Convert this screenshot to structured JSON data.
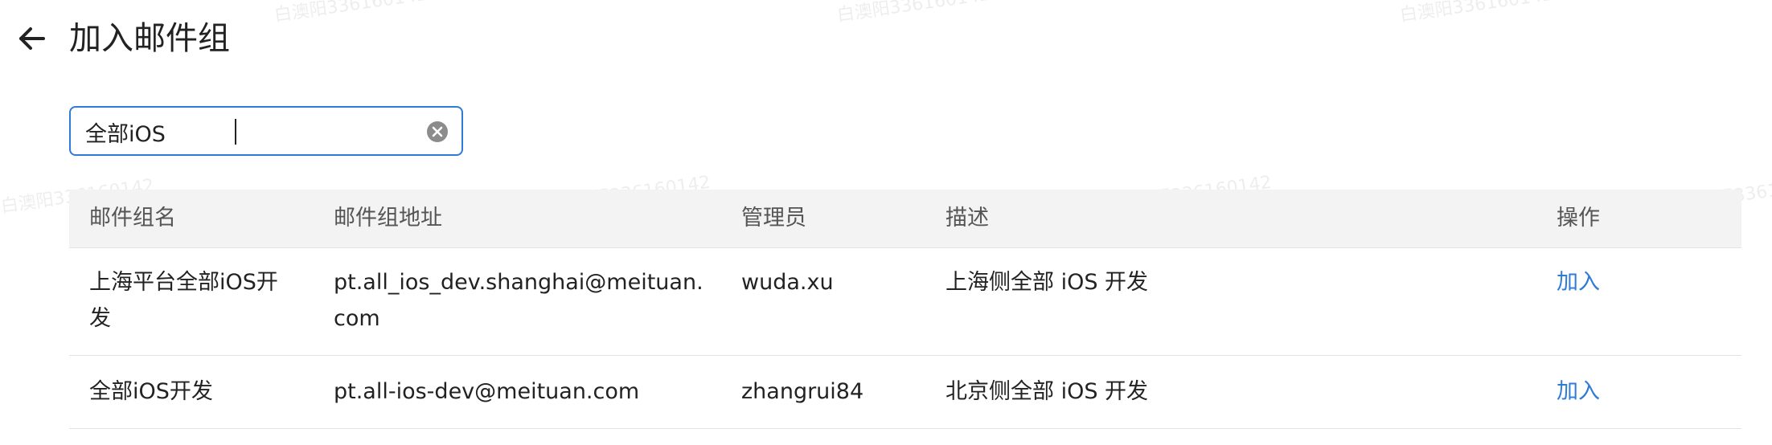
{
  "header": {
    "title": "加入邮件组",
    "back_icon": "arrow-left-icon"
  },
  "search": {
    "value": "全部iOS",
    "clear_icon": "clear-circle-icon"
  },
  "table": {
    "columns": [
      "邮件组名",
      "邮件组地址",
      "管理员",
      "描述",
      "操作"
    ],
    "rows": [
      {
        "name": "上海平台全部iOS开发",
        "address": "pt.all_ios_dev.shanghai@meituan.com",
        "admin": "wuda.xu",
        "description": "上海侧全部 iOS 开发",
        "action": "加入"
      },
      {
        "name": "全部iOS开发",
        "address": "pt.all-ios-dev@meituan.com",
        "admin": "zhangrui84",
        "description": "北京侧全部 iOS 开发",
        "action": "加入"
      }
    ]
  },
  "watermark": {
    "text": "白澳阳336160142"
  },
  "colors": {
    "accent": "#2f7bd6",
    "header_bg": "#f3f3f3",
    "border": "#e3e3e3"
  }
}
